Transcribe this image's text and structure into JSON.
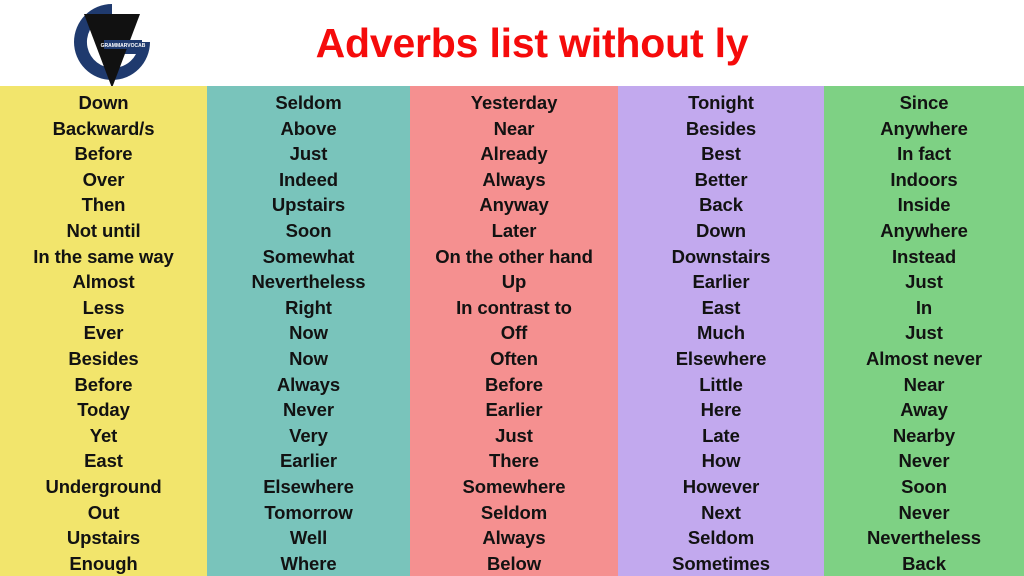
{
  "header": {
    "title": "Adverbs list without ly",
    "title_color": "#f50b0b",
    "logo": {
      "icon": "grammarvocab-logo",
      "mark_text": "GRAMMARVOCAB",
      "ring_color": "#1f3a6e",
      "v_color": "#111111"
    }
  },
  "columns": [
    {
      "name": "column-1",
      "color": "#f2e56c",
      "words": [
        "Down",
        "Backward/s",
        "Before",
        "Over",
        "Then",
        "Not until",
        "In the same way",
        "Almost",
        "Less",
        "Ever",
        "Besides",
        "Before",
        "Today",
        "Yet",
        "East",
        "Underground",
        "Out",
        "Upstairs",
        "Enough"
      ]
    },
    {
      "name": "column-2",
      "color": "#79c4bb",
      "words": [
        "Seldom",
        "Above",
        "Just",
        "Indeed",
        "Upstairs",
        "Soon",
        "Somewhat",
        "Nevertheless",
        "Right",
        "Now",
        "Now",
        "Always",
        "Never",
        "Very",
        "Earlier",
        "Elsewhere",
        "Tomorrow",
        "Well",
        "Where"
      ]
    },
    {
      "name": "column-3",
      "color": "#f59090",
      "words": [
        "Yesterday",
        "Near",
        "Already",
        "Always",
        "Anyway",
        "Later",
        "On the other hand",
        "Up",
        "In contrast to",
        "Off",
        "Often",
        "Before",
        "Earlier",
        "Just",
        "There",
        "Somewhere",
        "Seldom",
        "Always",
        "Below"
      ]
    },
    {
      "name": "column-4",
      "color": "#c2a9ee",
      "words": [
        "Tonight",
        "Besides",
        "Best",
        "Better",
        "Back",
        "Down",
        "Downstairs",
        "Earlier",
        "East",
        "Much",
        "Elsewhere",
        "Little",
        "Here",
        "Late",
        "How",
        "However",
        "Next",
        "Seldom",
        "Sometimes"
      ]
    },
    {
      "name": "column-5",
      "color": "#7ed184",
      "words": [
        "Since",
        "Anywhere",
        "In fact",
        "Indoors",
        "Inside",
        "Anywhere",
        "Instead",
        "Just",
        "In",
        "Just",
        "Almost never",
        "Near",
        "Away",
        "Nearby",
        "Never",
        "Soon",
        "Never",
        "Nevertheless",
        "Back"
      ]
    }
  ]
}
